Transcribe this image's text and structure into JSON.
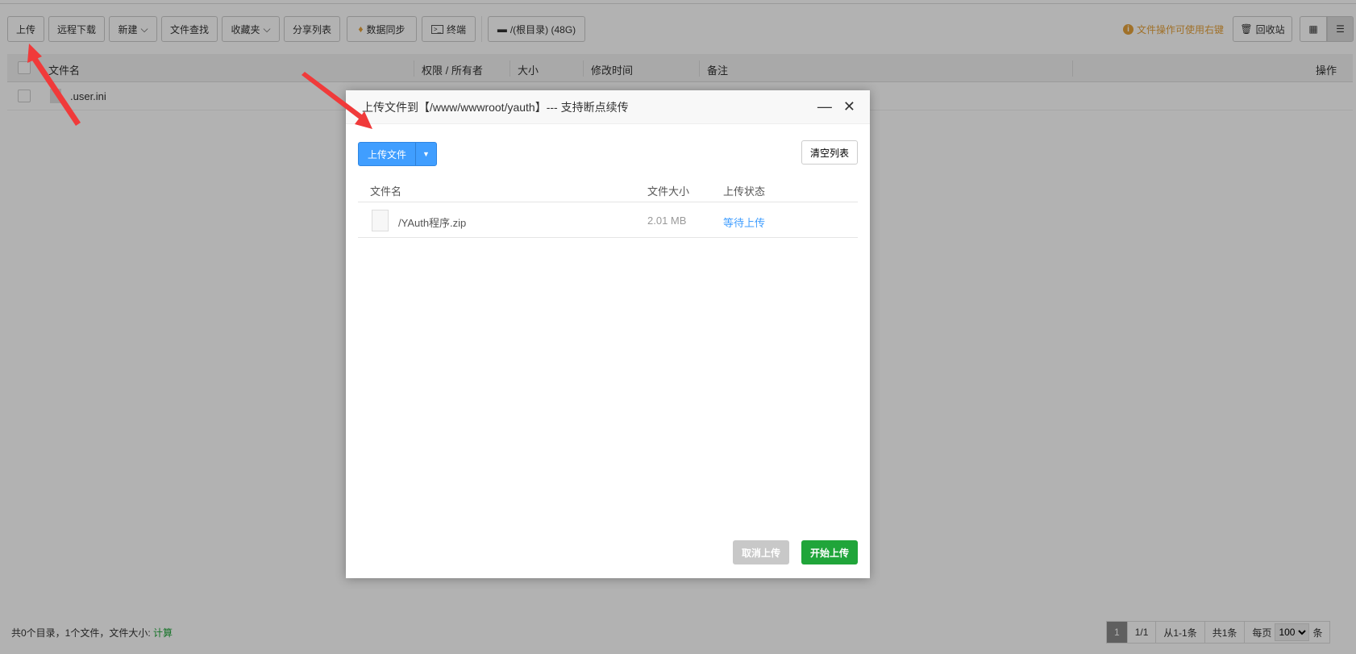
{
  "toolbar": {
    "upload": "上传",
    "remote_download": "远程下载",
    "new": "新建",
    "find": "文件查找",
    "favorites": "收藏夹",
    "share_list": "分享列表",
    "data_sync": "数据同步",
    "terminal": "终端",
    "disk": "/(根目录) (48G)",
    "hint": "文件操作可使用右键",
    "recycle": "回收站"
  },
  "table": {
    "headers": [
      "文件名",
      "权限 / 所有者",
      "大小",
      "修改时间",
      "备注",
      "操作"
    ],
    "rows": [
      {
        "name": ".user.ini"
      }
    ]
  },
  "footer": {
    "summary": "共0个目录，1个文件，文件大小:",
    "calc": "计算",
    "pager": {
      "current": "1",
      "pages": "1/1",
      "range": "从1-1条",
      "total": "共1条",
      "per_page_label": "每页",
      "per_page": "100",
      "unit": "条"
    }
  },
  "dialog": {
    "title": "上传文件到【/www/wwwroot/yauth】--- 支持断点续传",
    "upload_files": "上传文件",
    "clear_list": "清空列表",
    "headers": [
      "文件名",
      "文件大小",
      "上传状态"
    ],
    "files": [
      {
        "name": "/YAuth程序.zip",
        "size": "2.01 MB",
        "status": "等待上传"
      }
    ],
    "cancel": "取消上传",
    "start": "开始上传"
  },
  "colors": {
    "primary": "#409eff",
    "success": "#20a53a",
    "warning": "#e6a23c",
    "arrow": "#f03a3a"
  }
}
